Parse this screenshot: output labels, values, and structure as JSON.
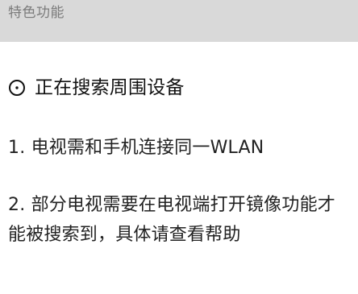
{
  "header": {
    "title": "特色功能"
  },
  "status": {
    "icon": "spinner-icon",
    "text": "正在搜索周围设备"
  },
  "tips": [
    "1. 电视需和手机连接同一WLAN",
    "2. 部分电视需要在电视端打开镜像功能才能被搜索到，具体请查看帮助"
  ],
  "colors": {
    "header_background": "#d9d9d9",
    "header_text": "#7b7b7b",
    "body_text": "#222222"
  }
}
